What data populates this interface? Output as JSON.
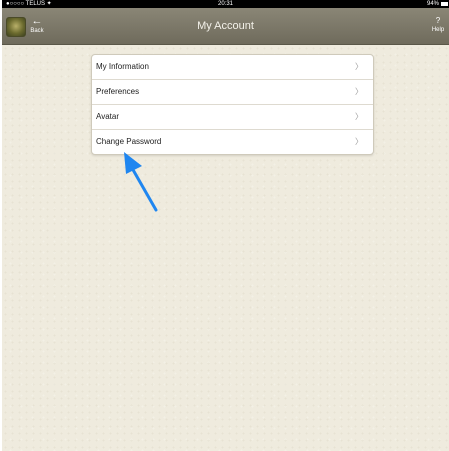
{
  "status_bar": {
    "carrier": "●○○○○ TELUS ✦",
    "time": "20:31",
    "battery": "94%"
  },
  "nav_bar": {
    "back_label": "Back",
    "back_arrow": "←",
    "title": "My Account",
    "help_symbol": "?",
    "help_label": "Help"
  },
  "menu": {
    "items": [
      {
        "label": "My Information",
        "chevron": "〉"
      },
      {
        "label": "Preferences",
        "chevron": "〉"
      },
      {
        "label": "Avatar",
        "chevron": "〉"
      },
      {
        "label": "Change Password",
        "chevron": "〉"
      }
    ]
  },
  "colors": {
    "nav_bar": "#7d7a6b",
    "background": "#efebde",
    "annotation_arrow": "#1f86f0"
  },
  "icons": {
    "logo": "seal-logo-icon",
    "back": "back-arrow-icon",
    "help": "help-icon",
    "chevron": "chevron-right-icon"
  }
}
